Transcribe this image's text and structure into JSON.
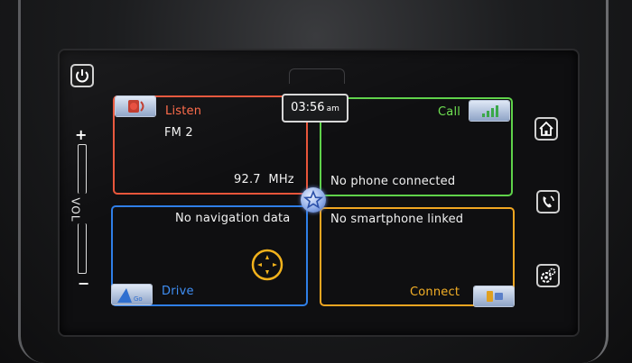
{
  "status": {
    "time": "03:56",
    "ampm": "am"
  },
  "tiles": {
    "listen": {
      "label": "Listen",
      "station": "FM 2",
      "frequency": "92.7  MHz"
    },
    "call": {
      "label": "Call",
      "status": "No phone connected"
    },
    "drive": {
      "label": "Drive",
      "status": "No navigation data"
    },
    "connect": {
      "label": "Connect",
      "status": "No smartphone linked"
    }
  },
  "volume": {
    "label": "VOL",
    "plus": "+",
    "minus": "−"
  },
  "colors": {
    "listen": "#e8553a",
    "call": "#5fd24a",
    "drive": "#2f7fe8",
    "connect": "#f1a621"
  },
  "icons": [
    "power-icon",
    "home-icon",
    "phone-icon",
    "settings-icon",
    "star-icon",
    "compass-icon",
    "music-icon",
    "signal-icon",
    "map-icon",
    "device-icon"
  ]
}
